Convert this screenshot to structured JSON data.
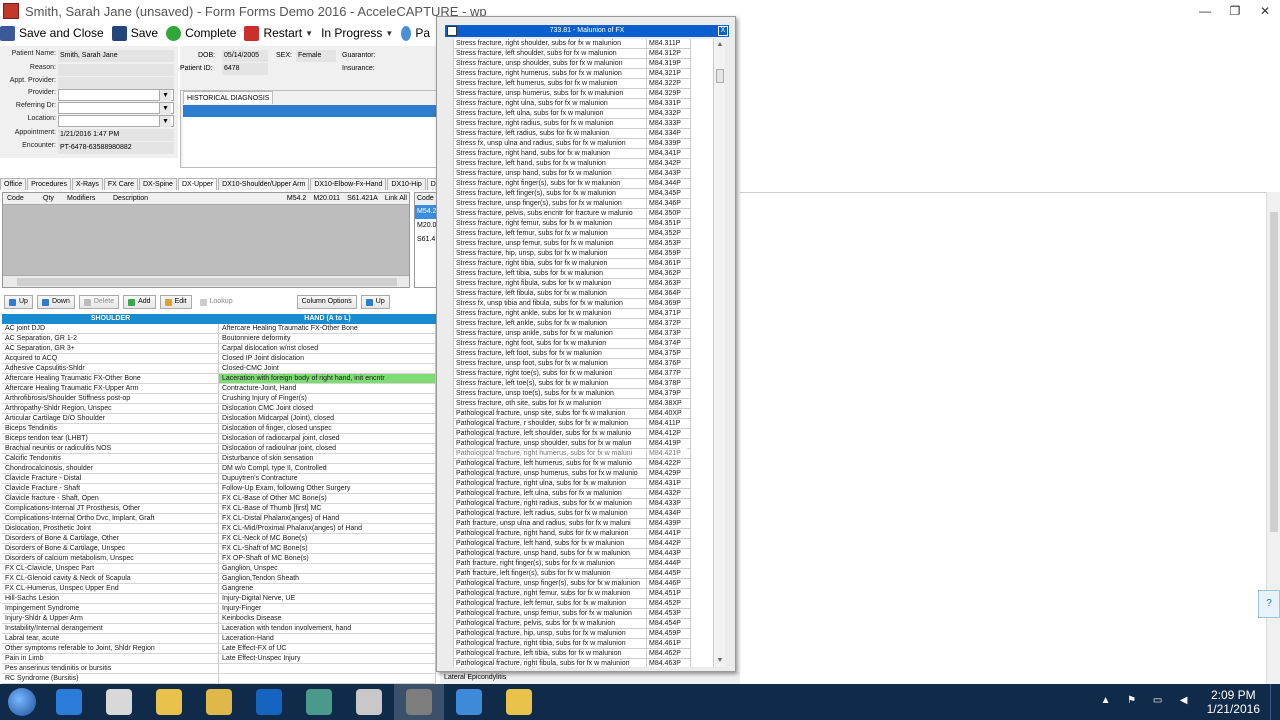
{
  "window": {
    "title": "Smith, Sarah Jane (unsaved) - Form Forms Demo 2016 - AcceleCAPTURE - wp",
    "controls": [
      "—",
      "❐",
      "✕"
    ]
  },
  "toolbar": {
    "save_close": "Save and Close",
    "save": "Save",
    "complete": "Complete",
    "restart": "Restart",
    "status": "In Progress",
    "pa": "Pa"
  },
  "patient": {
    "name_label": "Patient Name:",
    "name": "Smith, Sarah Jane",
    "reason_label": "Reason:",
    "appt_provider_label": "Appt. Provider:",
    "provider_label": "Provider:",
    "referring_label": "Referring Dr:",
    "location_label": "Location:",
    "appointment_label": "Appointment:",
    "appointment": "1/21/2016 1:47 PM",
    "encounter_label": "Encounter:",
    "encounter": "PT-6478-63588980882",
    "dob_label": "DOB:",
    "dob": "05/14/2005",
    "sex_label": "SEX:",
    "sex": "Female",
    "guarantor_label": "Guarantor:",
    "patient_id_label": "Patient ID:",
    "patient_id": "6478",
    "insurance_label": "Insurance:"
  },
  "history": {
    "tab": "HISTORICAL DIAGNOSIS"
  },
  "tabs": [
    "Office",
    "Procedures",
    "X-Rays",
    "FX Care",
    "DX-Spine",
    "DX-Upper",
    "DX10-Shoulder/Upper Arm",
    "DX10-Elbow-Fx-Hand",
    "DX10-Hip",
    "DX"
  ],
  "active_tab": "DX-Upper",
  "code_grid": {
    "columns": [
      "Code",
      "Qty",
      "Modifiers",
      "Description"
    ],
    "linked": [
      "M54.2",
      "M20.011",
      "S61.421A",
      "Link All"
    ],
    "side_header": "Code",
    "side_codes": [
      "M54.2",
      "M20.0",
      "S61.4"
    ]
  },
  "buttons": {
    "up": "Up",
    "down": "Down",
    "delete": "Delete",
    "add": "Add",
    "edit": "Edit",
    "lookup": "Lookup",
    "column_options": "Column Options",
    "up2": "Up"
  },
  "shoulder": {
    "title": "SHOULDER",
    "items": [
      "AC joint DJD",
      "AC Separation, GR 1-2",
      "AC Separation, GR 3+",
      "Acquired to ACQ",
      "Adhesive Capsulitis-Shldr",
      "Aftercare Healing Traumatic FX-Other Bone",
      "Aftercare Healing Traumatic FX-Upper Arm",
      "Arthrofibrosis/Shoulder Stiffness post-op",
      "Arthropathy-Shldr Region, Unspec",
      "Articular Cartilage D/O Shoulder",
      "Biceps Tendinitis",
      "Biceps tendon tear (LHBT)",
      "Brachial neuritis or radiculitis NOS",
      "Calcific Tendonitis",
      "Chondrocalcinosis, shoulder",
      "Clavicle Fracture - Distal",
      "Clavicle Fracture - Shaft",
      "Clavicle fracture - Shaft, Open",
      "Complications-Internal JT Prosthesis, Other",
      "Complications-Internal Ortho Dvc, Implant, Graft",
      "Dislocation, Prosthetic Joint",
      "Disorders of Bone & Cartilage, Other",
      "Disorders of Bone & Cartilage, Unspec",
      "Disorders of calcium metabolism, Unspec",
      "FX CL-Clavicle, Unspec Part",
      "FX CL-Glenoid cavity & Neck of Scapula",
      "FX CL-Humerus, Unspec Upper End",
      "Hill-Sachs Lesion",
      "Impingement Syndrome",
      "Injury-Shldr & Upper Arm",
      "Instability/Internal derangement",
      "Labral tear, acute",
      "Other symptoms referable to Joint, Shldr Region",
      "Pain in Limb",
      "Pes anserinus tendinitis or bursitis",
      "RC Syndrome (Bursitis)"
    ]
  },
  "hand": {
    "title": "HAND (A to L)",
    "highlight_index": 5,
    "items": [
      "Aftercare Healing Traumatic FX-Other Bone",
      "Boutonniere deformity",
      "Carpal dislocation w/rist closed",
      "Closed IP Joint dislocation",
      "Closed-CMC Joint",
      "Laceration with foreign body of right hand, init encntr",
      "Contracture-Joint, Hand",
      "Crushing Injury of Finger(s)",
      "Dislocation CMC Joint closed",
      "Dislocation Midcarpal (Joint), closed",
      "Dislocation of finger, closed unspec",
      "Dislocation of radiocarpal joint, closed",
      "Dislocation of radioulnar joint, closed",
      "Disturbance of skin sensation",
      "DM w/o Compl, type II, Controlled",
      "Dupuytren's Contracture",
      "Follow-Up Exam, following Other Surgery",
      "FX CL-Base of Other MC Bone(s)",
      "FX CL-Base of Thumb [first] MC",
      "FX CL-Distal Phalanx(anges) of Hand",
      "FX CL-Mid/Proximal Phalanx(anges) of Hand",
      "FX CL-Neck of MC Bone(s)",
      "FX CL-Shaft of MC Bone(s)",
      "FX OP-Shaft of MC Bone(s)",
      "Ganglion, Unspec",
      "Ganglion,Tendon Sheath",
      "Gangrene",
      "Injury-Digital Nerve, UE",
      "Injury-Finger",
      "Keinbocks Disease",
      "Laceration with tendon involvement, hand",
      "Laceration-Hand",
      "Late Effect-FX of UC",
      "Late Effect-Unspec Injury",
      "",
      ""
    ]
  },
  "popup": {
    "title": "733.81 - Malunion of FX",
    "close": "X",
    "selected_index": 41,
    "rows": [
      [
        "Stress fracture, right shoulder, subs for fx w malunion",
        "M84.311P"
      ],
      [
        "Stress fracture, left shoulder, subs for fx w malunion",
        "M84.312P"
      ],
      [
        "Stress fracture, unsp shoulder, subs for fx w malunion",
        "M84.319P"
      ],
      [
        "Stress fracture, right humerus, subs for fx w malunion",
        "M84.321P"
      ],
      [
        "Stress fracture, left humerus, subs for fx w malunion",
        "M84.322P"
      ],
      [
        "Stress fracture, unsp humerus, subs for fx w malunion",
        "M84.329P"
      ],
      [
        "Stress fracture, right ulna, subs for fx w malunion",
        "M84.331P"
      ],
      [
        "Stress fracture, left ulna, subs for fx w malunion",
        "M84.332P"
      ],
      [
        "Stress fracture, right radius, subs for fx w malunion",
        "M84.333P"
      ],
      [
        "Stress fracture, left radius, subs for fx w malunion",
        "M84.334P"
      ],
      [
        "Stress fx, unsp ulna and radius, subs for fx w malunion",
        "M84.339P"
      ],
      [
        "Stress fracture, right hand, subs for fx w malunion",
        "M84.341P"
      ],
      [
        "Stress fracture, left hand, subs for fx w malunion",
        "M84.342P"
      ],
      [
        "Stress fracture, unsp hand, subs for fx w malunion",
        "M84.343P"
      ],
      [
        "Stress fracture, right finger(s), subs for fx w malunion",
        "M84.344P"
      ],
      [
        "Stress fracture, left finger(s), subs for fx w malunion",
        "M84.345P"
      ],
      [
        "Stress fracture, unsp finger(s), subs for fx w malunion",
        "M84.346P"
      ],
      [
        "Stress fracture, pelvis, subs encntr for fracture w malunio",
        "M84.350P"
      ],
      [
        "Stress fracture, right femur, subs for fx w malunion",
        "M84.351P"
      ],
      [
        "Stress fracture, left femur, subs for fx w malunion",
        "M84.352P"
      ],
      [
        "Stress fracture, unsp femur, subs for fx w malunion",
        "M84.353P"
      ],
      [
        "Stress fracture, hip, unsp, subs for fx w malunion",
        "M84.359P"
      ],
      [
        "Stress fracture, right tibia, subs for fx w malunion",
        "M84.361P"
      ],
      [
        "Stress fracture, left tibia, subs for fx w malunion",
        "M84.362P"
      ],
      [
        "Stress fracture, right fibula, subs for fx w malunion",
        "M84.363P"
      ],
      [
        "Stress fracture, left fibula, subs for fx w malunion",
        "M84.364P"
      ],
      [
        "Stress fx, unsp tibia and fibula, subs for fx w malunion",
        "M84.369P"
      ],
      [
        "Stress fracture, right ankle, subs for fx w malunion",
        "M84.371P"
      ],
      [
        "Stress fracture, left ankle, subs for fx w malunion",
        "M84.372P"
      ],
      [
        "Stress fracture, unsp ankle, subs for fx w malunion",
        "M84.373P"
      ],
      [
        "Stress fracture, right foot, subs for fx w malunion",
        "M84.374P"
      ],
      [
        "Stress fracture, left foot, subs for fx w malunion",
        "M84.375P"
      ],
      [
        "Stress fracture, unsp foot, subs for fx w malunion",
        "M84.376P"
      ],
      [
        "Stress fracture, right toe(s), subs for fx w malunion",
        "M84.377P"
      ],
      [
        "Stress fracture, left toe(s), subs for fx w malunion",
        "M84.378P"
      ],
      [
        "Stress fracture, unsp toe(s), subs for fx w malunion",
        "M84.379P"
      ],
      [
        "Stress fracture, oth site, subs for fx w malunion",
        "M84.38XP"
      ],
      [
        "Pathological fracture, unsp site, subs for fx w malunion",
        "M84.40XP"
      ],
      [
        "Pathological fracture, r shoulder, subs for fx w malunion",
        "M84.411P"
      ],
      [
        "Pathological fracture, left shoulder, subs for fx w malunio",
        "M84.412P"
      ],
      [
        "Pathological fracture, unsp shoulder, subs for fx w malun",
        "M84.419P"
      ],
      [
        "Pathological fracture, right humerus, subs for fx w maluni",
        "M84.421P"
      ],
      [
        "Pathological fracture, left humerus, subs for fx w malunio",
        "M84.422P"
      ],
      [
        "Pathological fracture, unsp humerus, subs for fx w malunio",
        "M84.429P"
      ],
      [
        "Pathological fracture, right ulna, subs for fx w malunion",
        "M84.431P"
      ],
      [
        "Pathological fracture, left ulna, subs for fx w malunion",
        "M84.432P"
      ],
      [
        "Pathological fracture, right radius, subs for fx w malunion",
        "M84.433P"
      ],
      [
        "Pathological fracture, left radius, subs for fx w malunion",
        "M84.434P"
      ],
      [
        "Path fracture, unsp ulna and radius, subs for fx w maluni",
        "M84.439P"
      ],
      [
        "Pathological fracture, right hand, subs for fx w malunion",
        "M84.441P"
      ],
      [
        "Pathological fracture, left hand, subs for fx w malunion",
        "M84.442P"
      ],
      [
        "Pathological fracture, unsp hand, subs for fx w malunion",
        "M84.443P"
      ],
      [
        "Path fracture, right finger(s), subs for fx w malunion",
        "M84.444P"
      ],
      [
        "Path fracture, left finger(s), subs for fx w malunion",
        "M84.445P"
      ],
      [
        "Pathological fracture, unsp finger(s), subs for fx w malunion",
        "M84.446P"
      ],
      [
        "Pathological fracture, right femur, subs for fx w malunion",
        "M84.451P"
      ],
      [
        "Pathological fracture, left femur, subs for fx w malunion",
        "M84.452P"
      ],
      [
        "Pathological fracture, unsp femur, subs for fx w malunion",
        "M84.453P"
      ],
      [
        "Pathological fracture, pelvis, subs for fx w malunion",
        "M84.454P"
      ],
      [
        "Pathological fracture, hip, unsp, subs for fx w malunion",
        "M84.459P"
      ],
      [
        "Pathological fracture, right tibia, subs for fx w malunion",
        "M84.461P"
      ],
      [
        "Pathological fracture, left tibia, subs for fx w malunion",
        "M84.462P"
      ],
      [
        "Pathological fracture, right fibula, subs for fx w malunion",
        "M84.463P"
      ]
    ]
  },
  "bottom_strip": "Lateral Epicondylitis",
  "taskbar": {
    "time": "2:09 PM",
    "date": "1/21/2016",
    "apps": [
      "ie-icon",
      "notepad-icon",
      "notes-icon",
      "folder-icon",
      "outlook-icon",
      "tools-icon",
      "scissors-icon",
      "accelecapture-icon",
      "snowflake-icon",
      "bulb-icon"
    ]
  },
  "colors": {
    "list_header": "#1b8bd0",
    "highlight": "#7fdc74",
    "popup_title": "#0a5fcf",
    "taskbar": "#102a4a"
  }
}
